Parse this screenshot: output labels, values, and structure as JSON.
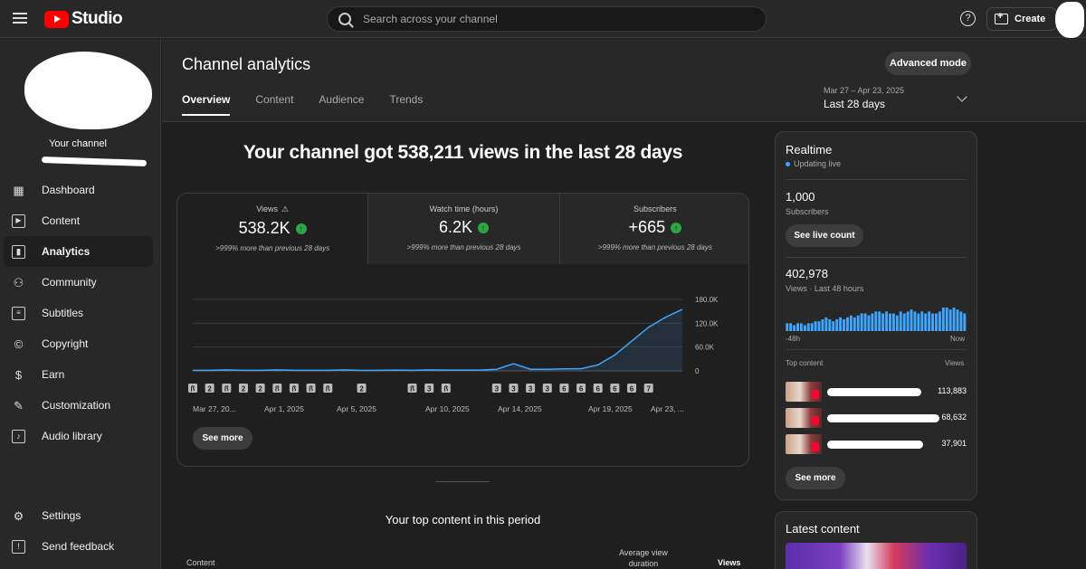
{
  "app": {
    "logo_text": "Studio"
  },
  "search": {
    "placeholder": "Search across your channel"
  },
  "topbar": {
    "help_icon": "help-icon",
    "create_label": "Create"
  },
  "sidebar": {
    "channel_label": "Your channel",
    "items": [
      {
        "label": "Dashboard",
        "icon": "dashboard-icon"
      },
      {
        "label": "Content",
        "icon": "content-icon"
      },
      {
        "label": "Analytics",
        "icon": "analytics-icon",
        "active": true
      },
      {
        "label": "Community",
        "icon": "community-icon"
      },
      {
        "label": "Subtitles",
        "icon": "subtitles-icon"
      },
      {
        "label": "Copyright",
        "icon": "copyright-icon"
      },
      {
        "label": "Earn",
        "icon": "earn-icon"
      },
      {
        "label": "Customization",
        "icon": "customization-icon"
      },
      {
        "label": "Audio library",
        "icon": "audio-library-icon"
      }
    ],
    "bottom": [
      {
        "label": "Settings",
        "icon": "gear-icon"
      },
      {
        "label": "Send feedback",
        "icon": "feedback-icon"
      }
    ]
  },
  "header": {
    "title": "Channel analytics",
    "advanced_mode": "Advanced mode",
    "tabs": [
      "Overview",
      "Content",
      "Audience",
      "Trends"
    ],
    "date_range_dates": "Mar 27 – Apr 23, 2025",
    "date_range_label": "Last 28 days"
  },
  "overview": {
    "headline": "Your channel got 538,211 views in the last 28 days",
    "metrics": [
      {
        "label": "Views",
        "value": "538.2K",
        "sub": ">999% more than previous 28 days"
      },
      {
        "label": "Watch time (hours)",
        "value": "6.2K",
        "sub": ">999% more than previous 28 days"
      },
      {
        "label": "Subscribers",
        "value": "+665",
        "sub": ">999% more than previous 28 days"
      }
    ],
    "see_more": "See more",
    "top_content_title": "Your top content in this period",
    "table_headers": {
      "content": "Content",
      "avg_view_duration_line1": "Average view",
      "avg_view_duration_line2": "duration",
      "views": "Views"
    }
  },
  "chart_data": {
    "type": "area",
    "xlabel_ticks": [
      "Mar 27, 20...",
      "Apr 1, 2025",
      "Apr 5, 2025",
      "Apr 10, 2025",
      "Apr 14, 2025",
      "Apr 19, 2025",
      "Apr 23, ..."
    ],
    "ytick_labels": [
      "0",
      "60.0K",
      "120.0K",
      "180.0K"
    ],
    "ylim": [
      0,
      180000
    ],
    "values": [
      1500,
      1500,
      2500,
      1500,
      1500,
      2500,
      1500,
      1500,
      1500,
      2500,
      1000,
      1500,
      2000,
      1500,
      2500,
      2000,
      2000,
      2000,
      4000,
      18000,
      4000,
      4000,
      5000,
      5500,
      15000,
      40000,
      75000,
      110000,
      135000,
      155000
    ],
    "color": "#3ea6ff",
    "markers": [
      {
        "day": 1,
        "label": "shorts"
      },
      {
        "day": 2,
        "label": "2"
      },
      {
        "day": 3,
        "label": "shorts"
      },
      {
        "day": 4,
        "label": "2"
      },
      {
        "day": 5,
        "label": "2"
      },
      {
        "day": 6,
        "label": "shorts"
      },
      {
        "day": 7,
        "label": "shorts"
      },
      {
        "day": 8,
        "label": "shorts"
      },
      {
        "day": 9,
        "label": "shorts"
      },
      {
        "day": 11,
        "label": "2"
      },
      {
        "day": 14,
        "label": "shorts"
      },
      {
        "day": 15,
        "label": "3"
      },
      {
        "day": 16,
        "label": "shorts"
      },
      {
        "day": 19,
        "label": "3"
      },
      {
        "day": 20,
        "label": "3"
      },
      {
        "day": 21,
        "label": "3"
      },
      {
        "day": 22,
        "label": "3"
      },
      {
        "day": 23,
        "label": "6"
      },
      {
        "day": 24,
        "label": "6"
      },
      {
        "day": 25,
        "label": "6"
      },
      {
        "day": 26,
        "label": "6"
      },
      {
        "day": 27,
        "label": "6"
      },
      {
        "day": 28,
        "label": "7"
      }
    ]
  },
  "realtime": {
    "title": "Realtime",
    "status": "Updating live",
    "subscribers_value": "1,000",
    "subscribers_label": "Subscribers",
    "see_live_count": "See live count",
    "views_value": "402,978",
    "views_label": "Views · Last 48 hours",
    "axis_left": "-48h",
    "axis_right": "Now",
    "bars": [
      4,
      4,
      3,
      4,
      4,
      3,
      4,
      4,
      5,
      5,
      6,
      7,
      6,
      5,
      6,
      7,
      6,
      7,
      8,
      7,
      8,
      9,
      9,
      8,
      9,
      10,
      10,
      9,
      10,
      9,
      9,
      8,
      10,
      9,
      10,
      11,
      10,
      9,
      10,
      9,
      10,
      9,
      9,
      10,
      12,
      12,
      11,
      12,
      11,
      10,
      9
    ],
    "top_content_label": "Top content",
    "views_col_label": "Views",
    "top_content": [
      {
        "views": "113,883"
      },
      {
        "views": "68,632"
      },
      {
        "views": "37,901"
      }
    ],
    "see_more": "See more"
  },
  "latest": {
    "title": "Latest content"
  }
}
